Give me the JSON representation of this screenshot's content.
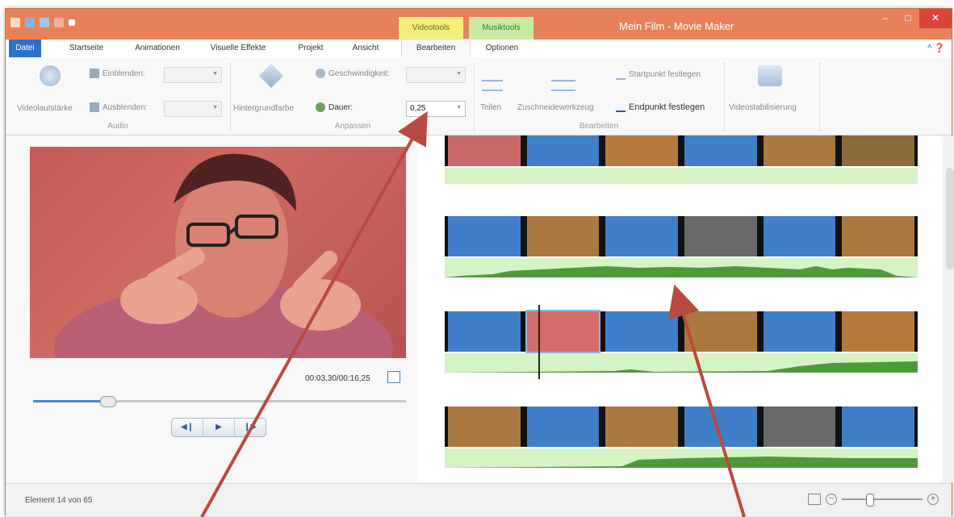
{
  "window": {
    "title": "Mein Film - Movie Maker",
    "minimize": "–",
    "maximize": "□",
    "close": "✕"
  },
  "context_tabs": {
    "video": "Videotools",
    "music": "Musiktools"
  },
  "tabs": [
    "Datei",
    "Startseite",
    "Animationen",
    "Visuelle Effekte",
    "Projekt",
    "Ansicht",
    "Bearbeiten",
    "Optionen"
  ],
  "active_tab": "Bearbeiten",
  "ribbon": {
    "audio": {
      "group_label": "Audio",
      "volume_label": "Videolautstärke",
      "fade_in_label": "Einblenden:",
      "fade_out_label": "Ausblenden:",
      "fade_in_value": "",
      "fade_out_value": ""
    },
    "adjust": {
      "group_label": "Anpassen",
      "background_label": "Hintergrundfarbe",
      "speed_label": "Geschwindigkeit:",
      "speed_value": "",
      "duration_label": "Dauer:",
      "duration_value": "0,25"
    },
    "edit": {
      "group_label": "Bearbeiten",
      "split_label": "Teilen",
      "trim_label": "Zuschneidewerkzeug",
      "start_label": "Startpunkt festlegen",
      "end_label": "Endpunkt festlegen"
    },
    "stabilize": {
      "label": "Videostabilisierung"
    }
  },
  "preview": {
    "timecode": "00:03,30/00:16,25",
    "seek_progress": 0.2,
    "controls": [
      "◀❙",
      "▶",
      "❙▶"
    ]
  },
  "status": {
    "text": "Element 14 von 65"
  },
  "colors": {
    "titlebar": "#e8815a",
    "file_tab": "#2b70c9",
    "videotools": "#f3ee7a",
    "musiktools": "#c7eba0",
    "audio_wave": "#4e9a3a",
    "arrow": "#b84a3f"
  }
}
